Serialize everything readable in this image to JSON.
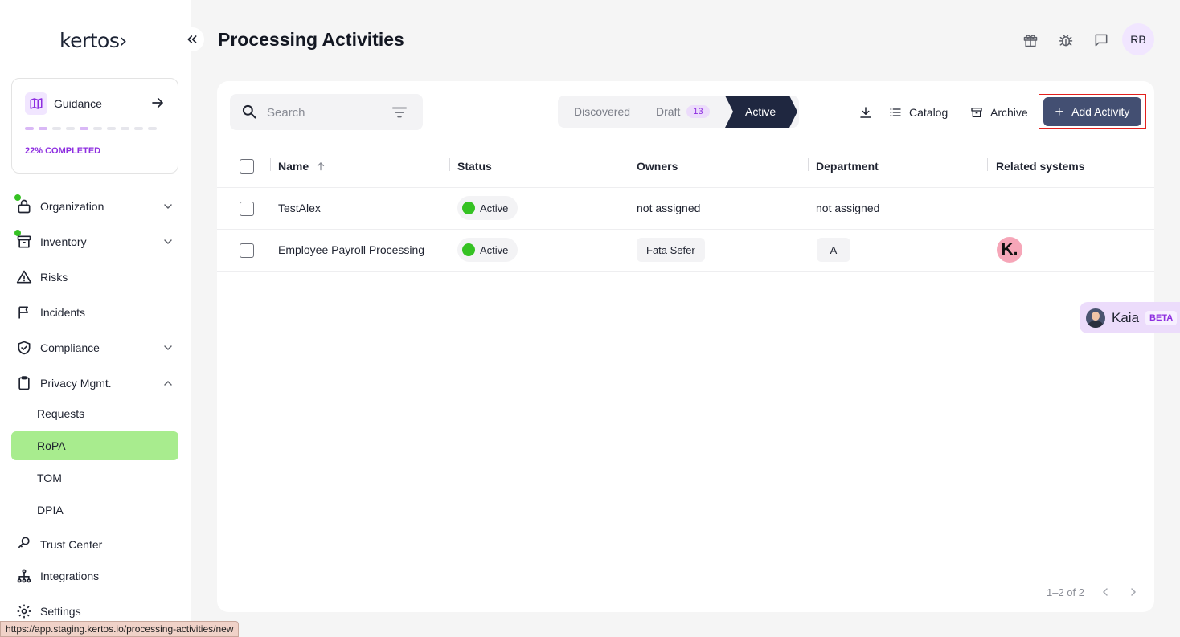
{
  "sidebar": {
    "logo": "kertos›",
    "guidance": {
      "label": "Guidance",
      "progress_text": "22% COMPLETED",
      "progress_fraction": 0.22
    },
    "nav": {
      "organization": "Organization",
      "inventory": "Inventory",
      "risks": "Risks",
      "incidents": "Incidents",
      "compliance": "Compliance",
      "privacy": "Privacy Mgmt.",
      "trust_center": "Trust Center",
      "integrations": "Integrations",
      "settings": "Settings"
    },
    "privacy_sub": {
      "requests": "Requests",
      "ropa": "RoPA",
      "tom": "TOM",
      "dpia": "DPIA"
    }
  },
  "header": {
    "title": "Processing Activities",
    "avatar_initials": "RB",
    "icons": [
      "gift-icon",
      "bug-icon",
      "chat-icon"
    ]
  },
  "toolbar": {
    "search_placeholder": "Search",
    "stages": {
      "discovered": "Discovered",
      "draft": "Draft",
      "draft_count": "13",
      "active": "Active"
    },
    "catalog": "Catalog",
    "archive": "Archive",
    "add_activity": "Add Activity"
  },
  "table": {
    "columns": {
      "name": "Name",
      "status": "Status",
      "owners": "Owners",
      "department": "Department",
      "related_systems": "Related systems"
    },
    "rows": [
      {
        "name": "TestAlex",
        "status": "Active",
        "owners": "not assigned",
        "department": "not assigned",
        "related_systems": ""
      },
      {
        "name": "Employee Payroll Processing",
        "status": "Active",
        "owners": "Fata Sefer",
        "department": "A",
        "related_systems": "K."
      }
    ]
  },
  "pagination": {
    "text": "1–2 of 2"
  },
  "assistant": {
    "name": "Kaia",
    "badge": "BETA"
  },
  "status_bar": {
    "url": "https://app.staging.kertos.io/processing-activities/new"
  },
  "colors": {
    "accent_purple": "#8e2ee0",
    "active_green": "#35c223",
    "selected_nav": "#a8ec8e",
    "primary_button": "#434f72",
    "stage_active": "#1f2740"
  }
}
